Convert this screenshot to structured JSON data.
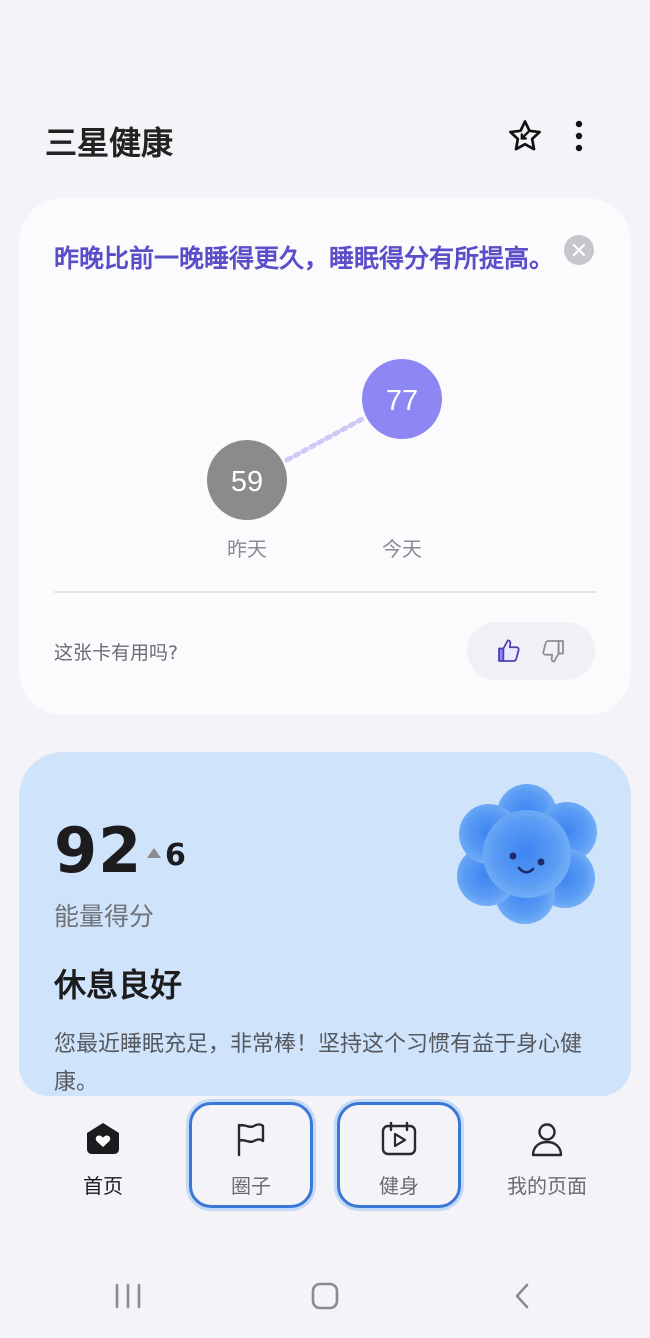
{
  "header": {
    "title": "三星健康"
  },
  "insight_card": {
    "message": "昨晚比前一晚睡得更久，睡眠得分有所提高。",
    "yesterday": {
      "score": "59",
      "label": "昨天",
      "color": "#8b8b8e"
    },
    "today": {
      "score": "77",
      "label": "今天",
      "color": "#8d86f3"
    },
    "feedback_question": "这张卡有用吗?"
  },
  "energy_card": {
    "score": "92",
    "delta": "6",
    "score_label": "能量得分",
    "status_title": "休息良好",
    "status_desc": "您最近睡眠充足，非常棒！坚持这个习惯有益于身心健康。",
    "background": "#cfe3fb"
  },
  "bottom_nav": {
    "items": [
      {
        "label": "首页",
        "icon": "home-heart-icon",
        "active": true
      },
      {
        "label": "圈子",
        "icon": "flag-icon",
        "focused": true
      },
      {
        "label": "健身",
        "icon": "fitness-calendar-icon",
        "focused": true
      },
      {
        "label": "我的页面",
        "icon": "person-icon"
      }
    ]
  },
  "colors": {
    "accent_purple": "#5b4fc9",
    "focus_ring": "#3a78d8"
  }
}
